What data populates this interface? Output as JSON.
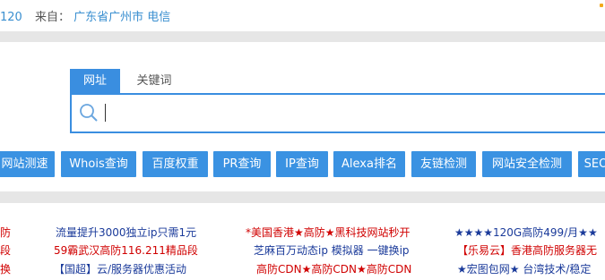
{
  "ipbar": {
    "ip_fragment": "120",
    "from_label": "来自：",
    "location": "广东省广州市 电信"
  },
  "search": {
    "tabs": [
      {
        "label": "网址",
        "active": true
      },
      {
        "label": "关键词",
        "active": false
      }
    ],
    "input_value": "",
    "accent_color": "#3a8ee0"
  },
  "tools": [
    "网站测速",
    "Whois查询",
    "百度权重",
    "PR查询",
    "IP查询",
    "Alexa排名",
    "友链检测",
    "网站安全检测",
    "SEO"
  ],
  "ads": {
    "col0": [
      "防",
      "段",
      "换"
    ],
    "col1": [
      "流量提升3000独立ip只需1元",
      "59霸武汉高防116.211精品段",
      "【国超】云/服务器优惠活动"
    ],
    "col2": [
      "*美国香港★高防★黑科技网站秒开",
      "芝麻百万动态ip 模拟器 一键换ip",
      "高防CDN★高防CDN★高防CDN"
    ],
    "col3": [
      "★★★★120G高防499/月★★",
      "【乐易云】香港高防服务器无",
      "★宏图包网★ 台湾技术/稳定"
    ]
  }
}
